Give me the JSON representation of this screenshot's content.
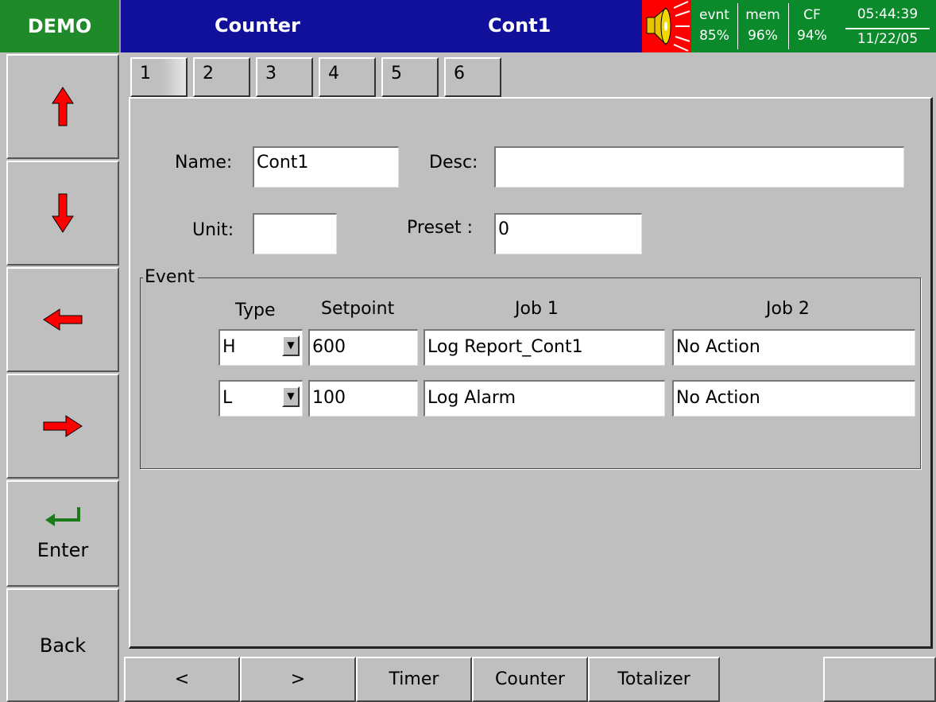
{
  "header": {
    "badge": "DEMO",
    "section": "Counter",
    "title": "Cont1",
    "evnt_label": "evnt",
    "evnt_value": "85%",
    "mem_label": "mem",
    "mem_value": "96%",
    "cf_label": "CF",
    "cf_value": "94%",
    "time": "05:44:39",
    "date": "11/22/05"
  },
  "left_buttons": {
    "up": "up-arrow-icon",
    "down": "down-arrow-icon",
    "left": "left-arrow-icon",
    "right": "right-arrow-icon",
    "enter": "Enter",
    "back": "Back"
  },
  "tabs": [
    "1",
    "2",
    "3",
    "4",
    "5",
    "6"
  ],
  "form": {
    "name_label": "Name:",
    "name_value": "Cont1",
    "desc_label": "Desc:",
    "desc_value": "",
    "unit_label": "Unit:",
    "unit_value": "",
    "preset_label": "Preset :",
    "preset_value": "0"
  },
  "event": {
    "group_label": "Event",
    "col_type": "Type",
    "col_setpoint": "Setpoint",
    "col_job1": "Job 1",
    "col_job2": "Job 2",
    "rows": [
      {
        "type": "H",
        "setpoint": "600",
        "job1": "Log Report_Cont1",
        "job2": "No Action"
      },
      {
        "type": "L",
        "setpoint": "100",
        "job1": "Log Alarm",
        "job2": "No Action"
      }
    ]
  },
  "bottom_bar": {
    "prev": "<",
    "next": ">",
    "timer": "Timer",
    "counter": "Counter",
    "totalizer": "Totalizer",
    "blank": ""
  },
  "colors": {
    "title_bar": "#10109a",
    "demo_bg": "#1e8a2a",
    "status_bg": "#0a8a2a",
    "alarm_red": "#ff0000",
    "arrow_red": "#ff0000",
    "enter_green": "#1a7a1a",
    "face": "#c0bfbf"
  }
}
